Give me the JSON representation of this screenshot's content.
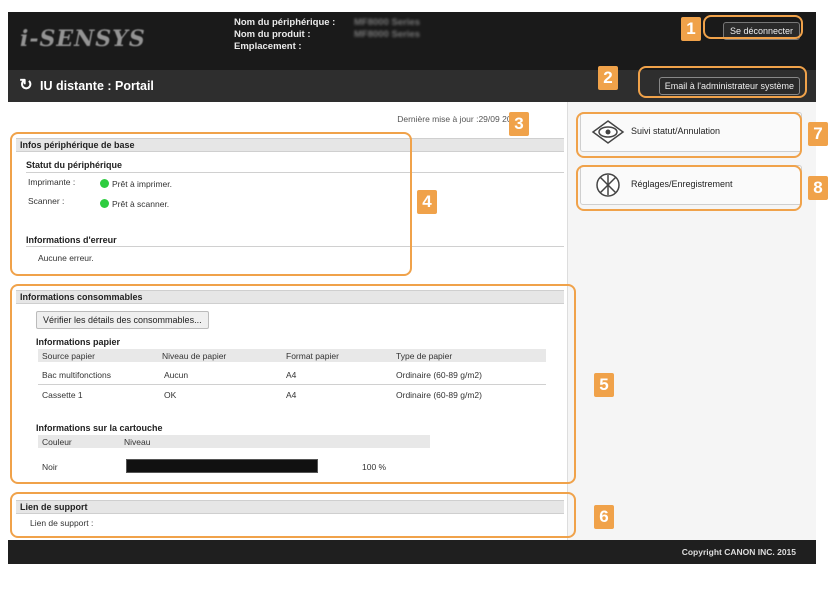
{
  "header": {
    "logo": "i-SENSYS",
    "device_name_label": "Nom du périphérique :",
    "device_name_value": "MF8000 Series",
    "product_name_label": "Nom du produit :",
    "product_name_value": "MF8000 Series",
    "location_label": "Emplacement :",
    "logout_label": "Se déconnecter",
    "portal_title": "IU distante : Portail",
    "email_admin_label": "Email à l'administrateur système"
  },
  "status_bar": {
    "last_update": "Dernière mise à jour :29/09 2015"
  },
  "basic_info": {
    "title": "Infos périphérique de base",
    "device_status_title": "Statut du périphérique",
    "printer_label": "Imprimante :",
    "printer_status": "Prêt à imprimer.",
    "scanner_label": "Scanner :",
    "scanner_status": "Prêt à scanner.",
    "status_color": "#2ecc40",
    "error_title": "Informations d'erreur",
    "error_value": "Aucune erreur."
  },
  "consumables": {
    "title": "Informations consommables",
    "check_button": "Vérifier les détails des consommables...",
    "paper_title": "Informations papier",
    "paper_columns": [
      "Source papier",
      "Niveau de papier",
      "Format papier",
      "Type de papier"
    ],
    "paper_rows": [
      [
        "Bac multifonctions",
        "Aucun",
        "A4",
        "Ordinaire (60-89 g/m2)"
      ],
      [
        "Cassette 1",
        "OK",
        "A4",
        "Ordinaire (60-89 g/m2)"
      ]
    ],
    "cartridge_title": "Informations sur la cartouche",
    "cartridge_columns": [
      "Couleur",
      "Niveau"
    ],
    "cartridge_rows": [
      {
        "color": "Noir",
        "level_percent": 100,
        "level_text": "100 %"
      }
    ]
  },
  "support": {
    "title": "Lien de support",
    "link_label": "Lien de support :"
  },
  "menu": {
    "status_monitor": "Suivi statut/Annulation",
    "settings": "Réglages/Enregistrement"
  },
  "footer": {
    "copyright": "Copyright CANON INC. 2015"
  },
  "callouts": [
    "1",
    "2",
    "3",
    "4",
    "5",
    "6",
    "7",
    "8"
  ],
  "colors": {
    "callout": "#f0a24a",
    "header_bg": "#1a1a1a"
  }
}
